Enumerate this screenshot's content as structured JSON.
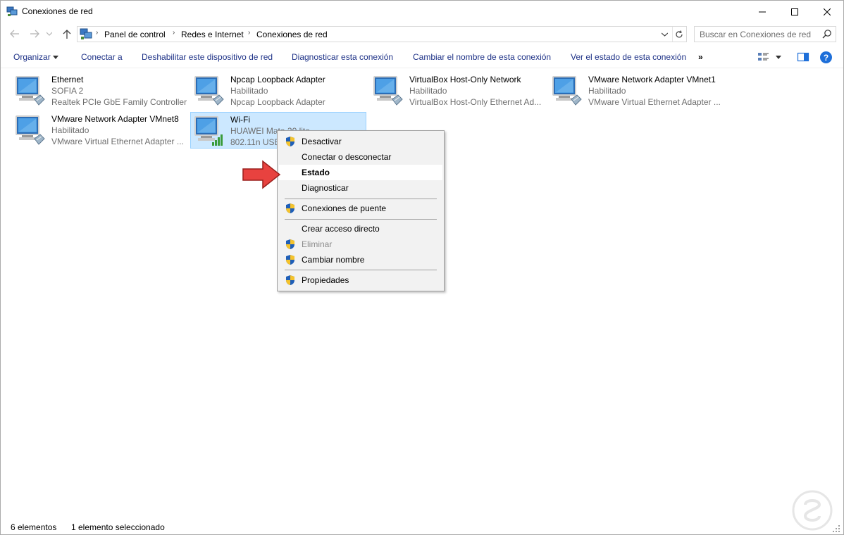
{
  "window": {
    "title": "Conexiones de red"
  },
  "address": {
    "crumbs": [
      "Panel de control",
      "Redes e Internet",
      "Conexiones de red"
    ],
    "search_placeholder": "Buscar en Conexiones de red"
  },
  "toolbar": {
    "organize": "Organizar",
    "connect": "Conectar a",
    "disable": "Deshabilitar este dispositivo de red",
    "diagnose": "Diagnosticar esta conexión",
    "rename": "Cambiar el nombre de esta conexión",
    "view_status": "Ver el estado de esta conexión",
    "more": "»"
  },
  "connections": [
    {
      "name": "Ethernet",
      "line1": "SOFIA 2",
      "line2": "Realtek PCIe GbE Family Controller",
      "icon": "ethernet-adapter-icon"
    },
    {
      "name": "Npcap Loopback Adapter",
      "line1": "Habilitado",
      "line2": "Npcap Loopback Adapter",
      "icon": "ethernet-adapter-icon"
    },
    {
      "name": "VirtualBox Host-Only Network",
      "line1": "Habilitado",
      "line2": "VirtualBox Host-Only Ethernet Ad...",
      "icon": "ethernet-adapter-icon"
    },
    {
      "name": "VMware Network Adapter VMnet1",
      "line1": "Habilitado",
      "line2": "VMware Virtual Ethernet Adapter ...",
      "icon": "ethernet-adapter-icon"
    },
    {
      "name": "VMware Network Adapter VMnet8",
      "line1": "Habilitado",
      "line2": "VMware Virtual Ethernet Adapter ...",
      "icon": "ethernet-adapter-icon"
    },
    {
      "name": "Wi-Fi",
      "line1": "HUAWEI Mate 20 lite",
      "line2": "802.11n USB",
      "icon": "wifi-adapter-icon",
      "selected": true
    }
  ],
  "context_menu": {
    "items": [
      {
        "label": "Desactivar",
        "shield": true
      },
      {
        "label": "Conectar o desconectar",
        "shield": false
      },
      {
        "label": "Estado",
        "shield": false,
        "bold": true,
        "highlighted": true
      },
      {
        "label": "Diagnosticar",
        "shield": false
      },
      {
        "label": "Conexiones de puente",
        "shield": true
      },
      {
        "label": "Crear acceso directo",
        "shield": false
      },
      {
        "label": "Eliminar",
        "shield": true,
        "disabled": true
      },
      {
        "label": "Cambiar nombre",
        "shield": true
      },
      {
        "label": "Propiedades",
        "shield": true
      }
    ]
  },
  "status_bar": {
    "count": "6 elementos",
    "selected": "1 elemento seleccionado"
  },
  "colors": {
    "selection_bg": "#cce8ff",
    "command_text": "#1e3287",
    "arrow": "#e8423f"
  }
}
